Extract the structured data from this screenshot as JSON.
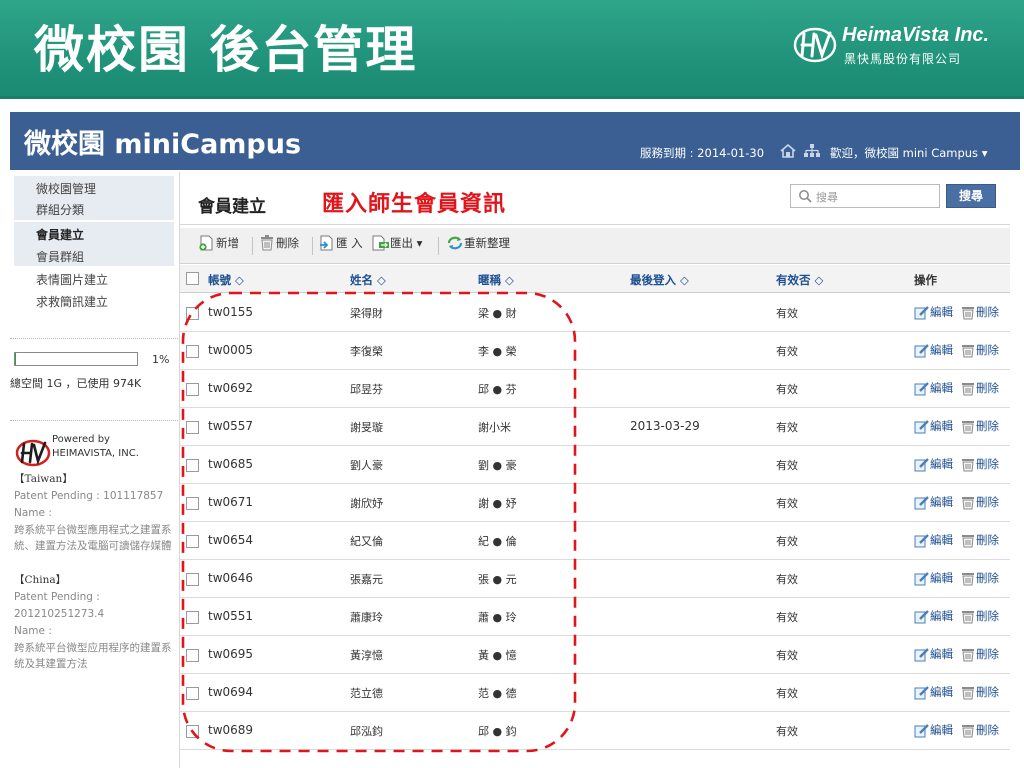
{
  "slide": {
    "title": "微校園 後台管理",
    "brand_name": "HeimaVista Inc.",
    "brand_sub": "黑快馬股份有限公司"
  },
  "app": {
    "title": "微校園 miniCampus",
    "service_expiry": "服務到期 : 2014-01-30",
    "welcome": "歡迎，微校園 mini Campus ▾"
  },
  "sidebar": {
    "group1": [
      "微校園管理",
      "群組分類"
    ],
    "group2": [
      "會員建立",
      "會員群組"
    ],
    "others": [
      "表情圖片建立",
      "求救簡訊建立"
    ],
    "storage_percent": 1,
    "storage_percent_label": "1%",
    "storage_text": "總空間 1G ，已使用 974K",
    "powered_by": "Powered by",
    "powered_name": "HEIMAVISTA, INC.",
    "taiwan_label": "【Taiwan】",
    "taiwan_patent": "Patent Pending : 101117857",
    "taiwan_name_label": "Name :",
    "taiwan_name": "跨系統平台微型應用程式之建置系統、建置方法及電腦可讀儲存媒體",
    "china_label": "【China】",
    "china_patent_label": "Patent Pending :",
    "china_patent": "201210251273.4",
    "china_name_label": "Name :",
    "china_name": "跨系統平台微型应用程序的建置系统及其建置方法"
  },
  "main": {
    "title": "會員建立",
    "annotation": "匯入師生會員資訊",
    "search_placeholder": "搜尋",
    "search_button": "搜尋",
    "toolbar": {
      "add": "新增",
      "delete": "刪除",
      "import": "匯 入",
      "export": "匯出 ▾",
      "refresh": "重新整理"
    },
    "columns": {
      "account": "帳號 ◇",
      "name": "姓名 ◇",
      "nickname": "暱稱 ◇",
      "last_login": "最後登入 ◇",
      "valid": "有效否 ◇",
      "actions": "操作"
    },
    "edit_label": "編輯",
    "delete_label": "刪除",
    "rows": [
      {
        "account": "tw0155",
        "name": "梁得財",
        "nickname": "梁 ● 財",
        "last_login": "",
        "valid": "有效"
      },
      {
        "account": "tw0005",
        "name": "李復榮",
        "nickname": "李 ● 榮",
        "last_login": "",
        "valid": "有效"
      },
      {
        "account": "tw0692",
        "name": "邱昱芬",
        "nickname": "邱 ● 芬",
        "last_login": "",
        "valid": "有效"
      },
      {
        "account": "tw0557",
        "name": "謝旻璇",
        "nickname": "謝小米",
        "last_login": "2013-03-29",
        "valid": "有效"
      },
      {
        "account": "tw0685",
        "name": "劉人豪",
        "nickname": "劉 ● 豪",
        "last_login": "",
        "valid": "有效"
      },
      {
        "account": "tw0671",
        "name": "謝欣妤",
        "nickname": "謝 ● 妤",
        "last_login": "",
        "valid": "有效"
      },
      {
        "account": "tw0654",
        "name": "紀又倫",
        "nickname": "紀 ● 倫",
        "last_login": "",
        "valid": "有效"
      },
      {
        "account": "tw0646",
        "name": "張嘉元",
        "nickname": "張 ● 元",
        "last_login": "",
        "valid": "有效"
      },
      {
        "account": "tw0551",
        "name": "蕭康玲",
        "nickname": "蕭 ● 玲",
        "last_login": "",
        "valid": "有效"
      },
      {
        "account": "tw0695",
        "name": "黃淳憶",
        "nickname": "黃 ● 憶",
        "last_login": "",
        "valid": "有效"
      },
      {
        "account": "tw0694",
        "name": "范立德",
        "nickname": "范 ● 德",
        "last_login": "",
        "valid": "有效"
      },
      {
        "account": "tw0689",
        "name": "邱泓鈞",
        "nickname": "邱 ● 鈞",
        "last_login": "",
        "valid": "有效"
      }
    ]
  },
  "colors": {
    "header_green": "#20937a",
    "app_bar_blue": "#3c5f93",
    "annotation_red": "#e0151b",
    "link_blue": "#1d4f91"
  }
}
